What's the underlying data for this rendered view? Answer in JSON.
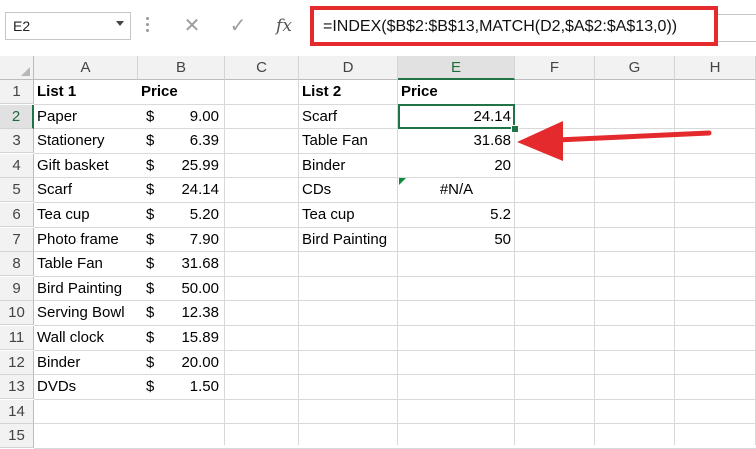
{
  "name_box": {
    "value": "E2"
  },
  "formula_bar": {
    "cancel_icon": "✕",
    "enter_icon": "✓",
    "fx_label": "fx",
    "formula": "=INDEX($B$2:$B$13,MATCH(D2,$A$2:$A$13,0))"
  },
  "columns": [
    "A",
    "B",
    "C",
    "D",
    "E",
    "F",
    "G",
    "H"
  ],
  "rows": [
    "1",
    "2",
    "3",
    "4",
    "5",
    "6",
    "7",
    "8",
    "9",
    "10",
    "11",
    "12",
    "13",
    "14",
    "15"
  ],
  "headers": {
    "list1": "List 1",
    "price_b": "Price",
    "list2": "List 2",
    "price_e": "Price"
  },
  "list1": [
    {
      "item": "Paper",
      "currency": "$",
      "price": "9.00"
    },
    {
      "item": "Stationery",
      "currency": "$",
      "price": "6.39"
    },
    {
      "item": "Gift basket",
      "currency": "$",
      "price": "25.99"
    },
    {
      "item": "Scarf",
      "currency": "$",
      "price": "24.14"
    },
    {
      "item": "Tea cup",
      "currency": "$",
      "price": "5.20"
    },
    {
      "item": "Photo frame",
      "currency": "$",
      "price": "7.90"
    },
    {
      "item": "Table Fan",
      "currency": "$",
      "price": "31.68"
    },
    {
      "item": "Bird Painting",
      "currency": "$",
      "price": "50.00"
    },
    {
      "item": "Serving Bowl",
      "currency": "$",
      "price": "12.38"
    },
    {
      "item": "Wall clock",
      "currency": "$",
      "price": "15.89"
    },
    {
      "item": "Binder",
      "currency": "$",
      "price": "20.00"
    },
    {
      "item": "DVDs",
      "currency": "$",
      "price": "1.50"
    }
  ],
  "list2": [
    {
      "item": "Scarf",
      "price": "24.14"
    },
    {
      "item": "Table Fan",
      "price": "31.68"
    },
    {
      "item": "Binder",
      "price": "20"
    },
    {
      "item": "CDs",
      "price": "#N/A"
    },
    {
      "item": "Tea cup",
      "price": "5.2"
    },
    {
      "item": "Bird Painting",
      "price": "50"
    }
  ],
  "selected_cell": {
    "column": "E",
    "row": "2"
  },
  "colors": {
    "highlight_red": "#e52a2e",
    "excel_green": "#217346",
    "grid": "#d9d9d9",
    "header_bg": "#f2f2f2"
  },
  "icons": {
    "arrow": "red-arrow-icon",
    "error_indicator": "error-triangle-icon"
  }
}
